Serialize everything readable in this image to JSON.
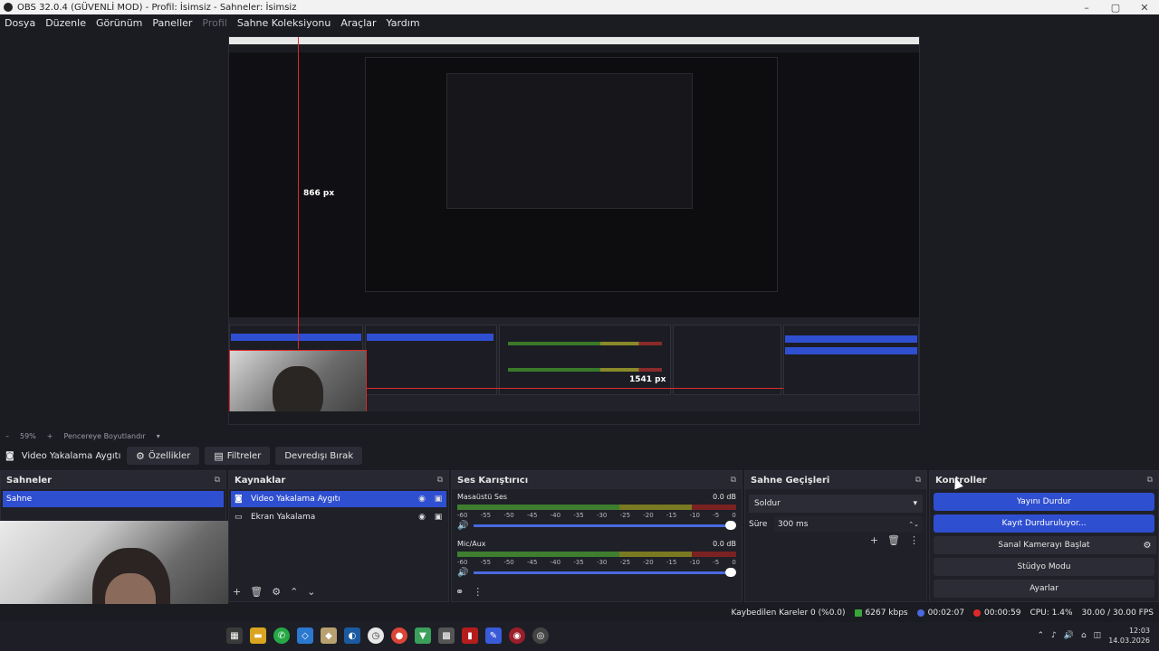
{
  "window": {
    "title": "OBS 32.0.4 (GÜVENLİ MOD) - Profil: İsimsiz - Sahneler: İsimsiz"
  },
  "menu": [
    "Dosya",
    "Düzenle",
    "Görünüm",
    "Paneller",
    "Profil",
    "Sahne Koleksiyonu",
    "Araçlar",
    "Yardım"
  ],
  "preview": {
    "measure_vertical": "866 px",
    "measure_horizontal": "1541 px",
    "zoom": "59%",
    "fit_label": "Pencereye Boyutlandır"
  },
  "context_bar": {
    "source_label": "Video Yakalama Aygıtı",
    "properties": "Özellikler",
    "filters": "Filtreler",
    "deactivate": "Devredışı Bırak"
  },
  "scenes": {
    "title": "Sahneler",
    "items": [
      "Sahne"
    ]
  },
  "sources": {
    "title": "Kaynaklar",
    "items": [
      "Video Yakalama Aygıtı",
      "Ekran Yakalama"
    ]
  },
  "mixer": {
    "title": "Ses Karıştırıcı",
    "tracks": [
      {
        "name": "Masaüstü Ses",
        "db": "0.0 dB"
      },
      {
        "name": "Mic/Aux",
        "db": "0.0 dB"
      }
    ],
    "scale": [
      "-60",
      "-55",
      "-50",
      "-45",
      "-40",
      "-35",
      "-30",
      "-25",
      "-20",
      "-15",
      "-10",
      "-5",
      "0"
    ]
  },
  "transitions": {
    "title": "Sahne Geçişleri",
    "selected": "Soldur",
    "duration_label": "Süre",
    "duration_value": "300 ms"
  },
  "controls": {
    "title": "Kontroller",
    "stop_stream": "Yayını Durdur",
    "stop_recording": "Kayıt Durduruluyor...",
    "virtual_cam": "Sanal Kamerayı Başlat",
    "studio_mode": "Stüdyo Modu",
    "settings": "Ayarlar"
  },
  "status": {
    "dropped": "Kaybedilen Kareler 0 (%0.0)",
    "bitrate": "6267 kbps",
    "stream_time": "00:02:07",
    "rec_time": "00:00:59",
    "cpu": "CPU: 1.4%",
    "fps": "30.00 / 30.00 FPS"
  },
  "clock": {
    "time": "12:03",
    "date": "14.03.2026"
  },
  "colors": {
    "accent": "#2f4fd1",
    "rec": "#e02a2a",
    "bg": "#1b1c22"
  }
}
